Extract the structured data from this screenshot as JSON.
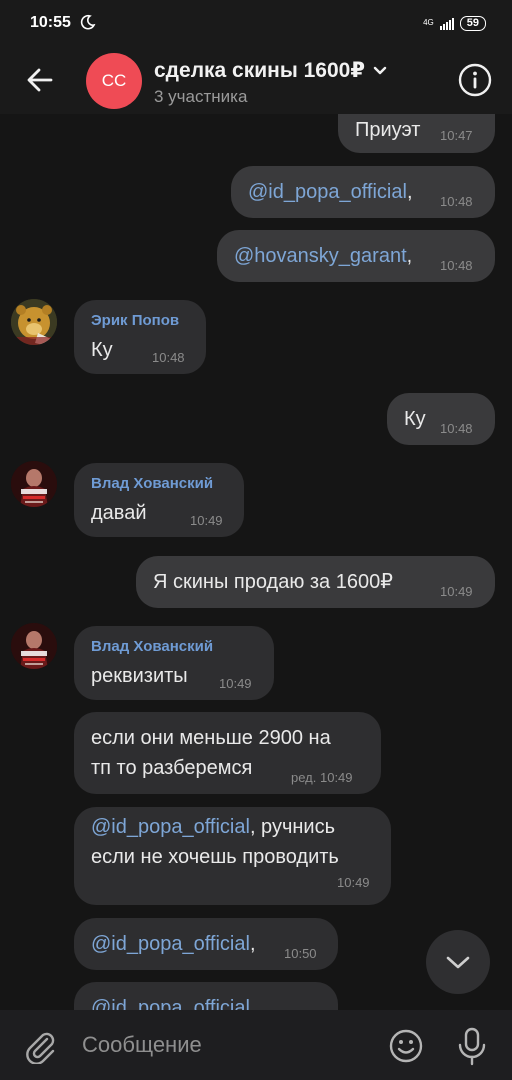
{
  "status_bar": {
    "time": "10:55",
    "network": "4G",
    "battery": "59",
    "icons": [
      "moon-icon",
      "signal-icon",
      "battery-icon"
    ]
  },
  "header": {
    "avatar_initials": "СС",
    "title": "сделка скины 1600₽",
    "subtitle": "3 участника",
    "icons": [
      "back-arrow-icon",
      "chevron-down-icon",
      "info-icon"
    ],
    "avatar_color": "#ef4b55"
  },
  "messages": [
    {
      "text": "Приуэт",
      "time": "10:47"
    },
    {
      "mention": "@id_popa_official",
      "text": ",",
      "time": "10:48"
    },
    {
      "mention": "@hovansky_garant",
      "text": ",",
      "time": "10:48"
    },
    {
      "sender": "Эрик Попов",
      "text": "Ку",
      "time": "10:48"
    },
    {
      "text": "Ку",
      "time": "10:48"
    },
    {
      "sender": "Влад Хованский",
      "text": "давай",
      "time": "10:49"
    },
    {
      "text": "Я скины продаю за 1600₽",
      "time": "10:49"
    },
    {
      "sender": "Влад Хованский",
      "text": "реквизиты",
      "time": "10:49"
    },
    {
      "line1": "если они меньше 2900 на",
      "line2": "тп то разберемся",
      "time": "ред. 10:49"
    },
    {
      "mention": "@id_popa_official",
      "line1": ", ручнись",
      "line2": "если не хочешь проводить",
      "time": "10:49"
    },
    {
      "mention": "@id_popa_official",
      "text": ",",
      "time": "10:50"
    },
    {
      "mention": "@id_popa_official"
    }
  ],
  "composer": {
    "placeholder": "Сообщение",
    "icons": [
      "paperclip-icon",
      "emoji-icon",
      "microphone-icon",
      "chevron-down-icon"
    ]
  },
  "colors": {
    "background": "#151515",
    "bubble_in": "#2e2e30",
    "bubble_out": "#3a3a3c",
    "mention": "#7ea6d6",
    "sender_name": "#6f9bd4"
  }
}
